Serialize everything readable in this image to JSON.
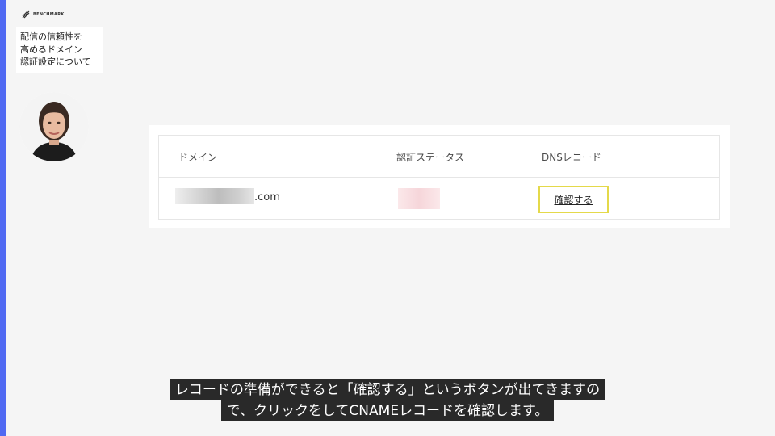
{
  "brand": {
    "logo_text": "BENCHMARK",
    "accent_color": "#5069f2"
  },
  "title": {
    "lines": [
      "配信の信頼性を",
      "高めるドメイン",
      "認証設定について"
    ]
  },
  "table": {
    "headers": {
      "domain": "ドメイン",
      "status": "認証ステータス",
      "dns": "DNSレコード"
    },
    "rows": [
      {
        "domain_suffix": ".com",
        "confirm_label": "確認する"
      }
    ],
    "highlight_color": "#e4d94a"
  },
  "subtitles": [
    "レコードの準備ができると「確認する」というボタンが出てきますの",
    "で、クリックをしてCNAMEレコードを確認します。"
  ],
  "icons": [
    "benchmark-logo-icon"
  ]
}
